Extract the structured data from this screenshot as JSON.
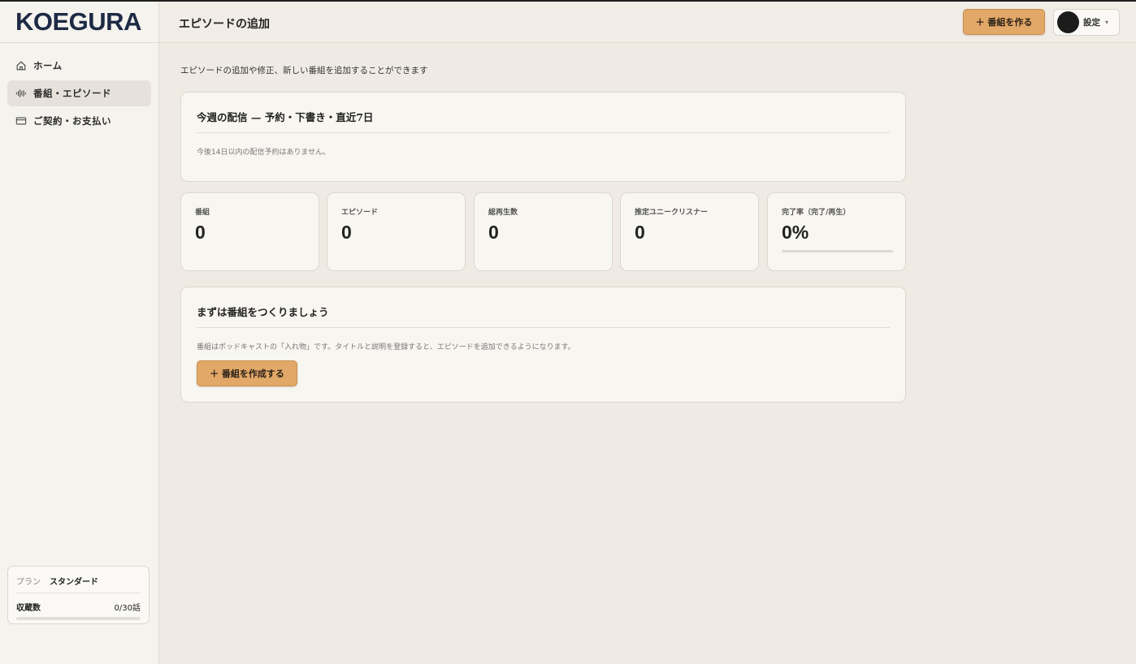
{
  "brand": {
    "logo": "KOEGURA"
  },
  "sidebar": {
    "items": [
      {
        "label": "ホーム",
        "icon": "home-icon",
        "active": false
      },
      {
        "label": "番組・エピソード",
        "icon": "waveform-icon",
        "active": true
      },
      {
        "label": "ご契約・お支払い",
        "icon": "credit-card-icon",
        "active": false
      }
    ],
    "plan": {
      "label": "プラン",
      "value": "スタンダード",
      "storage_label": "収蔵数",
      "storage_value": "0/30話",
      "storage_fraction": 0
    }
  },
  "header": {
    "title": "エピソードの追加",
    "create_button": "＋ 番組を作る",
    "settings_label": "設定",
    "caret": "▾"
  },
  "main": {
    "intro": "エピソードの追加や修正、新しい番組を追加することができます",
    "week_card": {
      "title": "今週の配信 — 予約・下書き・直近7日",
      "note": "今後14日以内の配信予約はありません。"
    },
    "stats": [
      {
        "label": "番組",
        "value": "0"
      },
      {
        "label": "エピソード",
        "value": "0"
      },
      {
        "label": "総再生数",
        "value": "0"
      },
      {
        "label": "推定ユニークリスナー",
        "value": "0"
      },
      {
        "label": "完了率（完了/再生）",
        "value": "0%",
        "progress": 0
      }
    ],
    "start_card": {
      "title": "まずは番組をつくりましょう",
      "note": "番組はポッドキャストの「入れ物」です。タイトルと説明を登録すると、エピソードを追加できるようになります。",
      "button": "＋ 番組を作成する"
    }
  },
  "colors": {
    "accent": "#e2a868",
    "brand": "#1d2a44",
    "background": "#efebe4",
    "card": "#f8f6f1"
  }
}
